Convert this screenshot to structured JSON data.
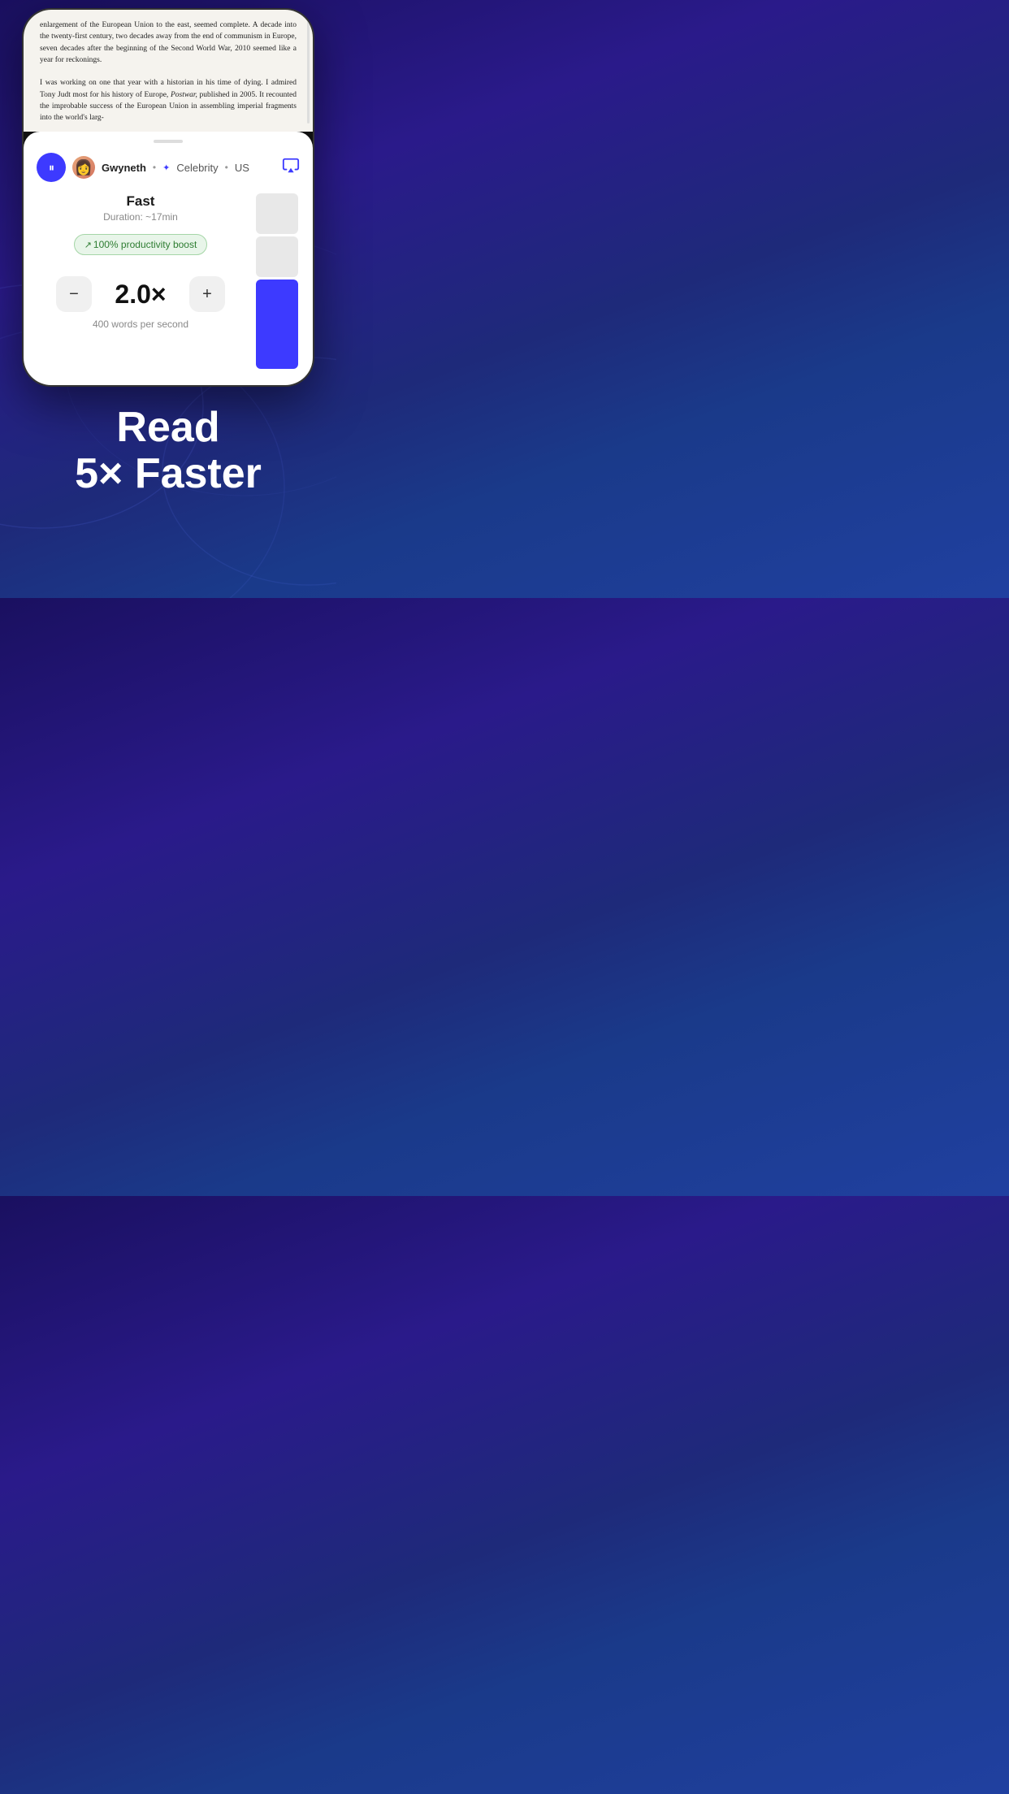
{
  "background": {
    "gradient_start": "#1a1060",
    "gradient_end": "#2040a0"
  },
  "book_text": {
    "paragraph1": "enlargement of the European Union to the east, seemed complete. A decade into the twenty-first century, two decades away from the end of communism in Europe, seven decades after the beginning of the Second World War, 2010 seemed like a year for reckonings.",
    "paragraph2": "I was working on one that year with a historian in his time of dying. I admired Tony Judt most for his history of Europe, Postwar, published in 2005. It recounted the improbable success of the European Union in assembling imperial fragments into the world's larg-"
  },
  "sheet_handle": "",
  "topbar": {
    "pause_label": "⏸",
    "avatar_emoji": "👩",
    "narrator_name": "Gwyneth",
    "dot1": "•",
    "sparkle": "✦",
    "category": "Celebrity",
    "dot2": "•",
    "country": "US",
    "airplay_icon": "📡"
  },
  "speed": {
    "label": "Fast",
    "duration_label": "Duration: ~17min",
    "productivity_badge": "↗ 100% productivity boost",
    "value": "2.0×",
    "minus_label": "−",
    "plus_label": "+",
    "words_per_second": "400 words per second"
  },
  "tagline": {
    "line1": "Read",
    "line2": "5× Faster"
  }
}
